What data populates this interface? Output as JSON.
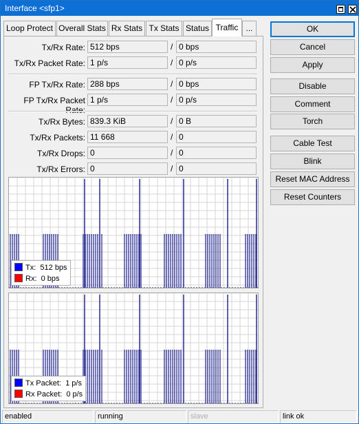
{
  "window": {
    "title": "Interface <sfp1>"
  },
  "tabs": [
    {
      "label": "Loop Protect",
      "active": false
    },
    {
      "label": "Overall Stats",
      "active": false
    },
    {
      "label": "Rx Stats",
      "active": false
    },
    {
      "label": "Tx Stats",
      "active": false
    },
    {
      "label": "Status",
      "active": false
    },
    {
      "label": "Traffic",
      "active": true
    },
    {
      "label": "...",
      "active": false
    }
  ],
  "stats": {
    "tx_rx_rate": {
      "label": "Tx/Rx Rate:",
      "tx": "512 bps",
      "rx": "0 bps"
    },
    "tx_rx_packet_rate": {
      "label": "Tx/Rx Packet Rate:",
      "tx": "1 p/s",
      "rx": "0 p/s"
    },
    "fp_tx_rx_rate": {
      "label": "FP Tx/Rx Rate:",
      "tx": "288 bps",
      "rx": "0 bps"
    },
    "fp_tx_rx_packet_rate": {
      "label": "FP Tx/Rx Packet Rate:",
      "tx": "1 p/s",
      "rx": "0 p/s"
    },
    "tx_rx_bytes": {
      "label": "Tx/Rx Bytes:",
      "tx": "839.3 KiB",
      "rx": "0 B"
    },
    "tx_rx_packets": {
      "label": "Tx/Rx Packets:",
      "tx": "11 668",
      "rx": "0"
    },
    "tx_rx_drops": {
      "label": "Tx/Rx Drops:",
      "tx": "0",
      "rx": "0"
    },
    "tx_rx_errors": {
      "label": "Tx/Rx Errors:",
      "tx": "0",
      "rx": "0"
    },
    "slash": "/"
  },
  "graphs": {
    "traffic": {
      "legend": [
        {
          "label": "Tx:",
          "value": "512 bps",
          "color": "#0000ff"
        },
        {
          "label": "Rx:",
          "value": "0 bps",
          "color": "#ff0000"
        }
      ]
    },
    "packets": {
      "legend": [
        {
          "label": "Tx Packet:",
          "value": "1 p/s",
          "color": "#0000ff"
        },
        {
          "label": "Rx Packet:",
          "value": "0 p/s",
          "color": "#ff0000"
        }
      ]
    },
    "line_color": "#1a1a8c"
  },
  "buttons": {
    "ok": "OK",
    "cancel": "Cancel",
    "apply": "Apply",
    "disable": "Disable",
    "comment": "Comment",
    "torch": "Torch",
    "cable_test": "Cable Test",
    "blink": "Blink",
    "reset_mac": "Reset MAC Address",
    "reset_counters": "Reset Counters"
  },
  "statusbar": {
    "state": "enabled",
    "running": "running",
    "slave": "slave",
    "link": "link ok"
  }
}
